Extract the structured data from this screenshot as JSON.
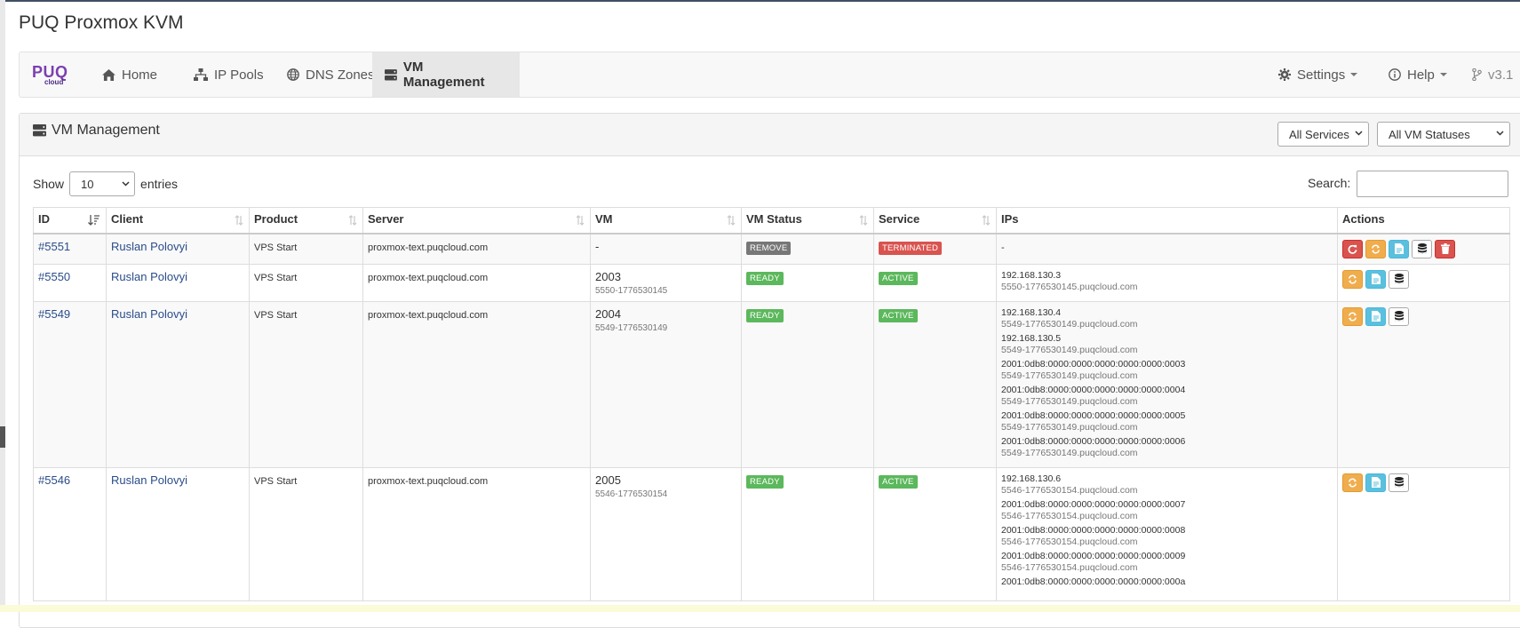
{
  "app": {
    "title": "PUQ Proxmox KVM",
    "logo_main": "PUQ",
    "logo_sub": "cloud"
  },
  "nav": {
    "items": [
      {
        "label": "Home",
        "icon": "home-icon"
      },
      {
        "label": "IP Pools",
        "icon": "sitemap-icon"
      },
      {
        "label": "DNS Zones",
        "icon": "globe-icon"
      },
      {
        "label": "VM Management",
        "icon": "server-icon",
        "active": true
      }
    ],
    "settings": "Settings",
    "help": "Help",
    "version": "v3.1"
  },
  "panel": {
    "title": "VM Management",
    "filter_services": "All Services",
    "filter_statuses": "All VM Statuses"
  },
  "table_controls": {
    "show": "Show",
    "entries_value": "10",
    "entries": "entries",
    "search": "Search:"
  },
  "columns": [
    "ID",
    "Client",
    "Product",
    "Server",
    "VM",
    "VM Status",
    "Service",
    "IPs",
    "Actions"
  ],
  "rows": [
    {
      "id": "#5551",
      "client": "Ruslan Polovyi",
      "product": "VPS Start",
      "server": "proxmox-text.puqcloud.com",
      "vm": "-",
      "vm_sub": "",
      "vm_status": "REMOVE",
      "service": "TERMINATED",
      "ips_text": "-",
      "ips": []
    },
    {
      "id": "#5550",
      "client": "Ruslan Polovyi",
      "product": "VPS Start",
      "server": "proxmox-text.puqcloud.com",
      "vm": "2003",
      "vm_sub": "5550-1776530145",
      "vm_status": "READY",
      "service": "ACTIVE",
      "ips_text": "",
      "ips": [
        {
          "addr": "192.168.130.3",
          "host": "5550-1776530145.puqcloud.com"
        }
      ]
    },
    {
      "id": "#5549",
      "client": "Ruslan Polovyi",
      "product": "VPS Start",
      "server": "proxmox-text.puqcloud.com",
      "vm": "2004",
      "vm_sub": "5549-1776530149",
      "vm_status": "READY",
      "service": "ACTIVE",
      "ips_text": "",
      "ips": [
        {
          "addr": "192.168.130.4",
          "host": "5549-1776530149.puqcloud.com"
        },
        {
          "addr": "192.168.130.5",
          "host": "5549-1776530149.puqcloud.com"
        },
        {
          "addr": "2001:0db8:0000:0000:0000:0000:0000:0003",
          "host": "5549-1776530149.puqcloud.com"
        },
        {
          "addr": "2001:0db8:0000:0000:0000:0000:0000:0004",
          "host": "5549-1776530149.puqcloud.com"
        },
        {
          "addr": "2001:0db8:0000:0000:0000:0000:0000:0005",
          "host": "5549-1776530149.puqcloud.com"
        },
        {
          "addr": "2001:0db8:0000:0000:0000:0000:0000:0006",
          "host": "5549-1776530149.puqcloud.com"
        }
      ]
    },
    {
      "id": "#5546",
      "client": "Ruslan Polovyi",
      "product": "VPS Start",
      "server": "proxmox-text.puqcloud.com",
      "vm": "2005",
      "vm_sub": "5546-1776530154",
      "vm_status": "READY",
      "service": "ACTIVE",
      "ips_text": "",
      "ips": [
        {
          "addr": "192.168.130.6",
          "host": "5546-1776530154.puqcloud.com"
        },
        {
          "addr": "2001:0db8:0000:0000:0000:0000:0000:0007",
          "host": "5546-1776530154.puqcloud.com"
        },
        {
          "addr": "2001:0db8:0000:0000:0000:0000:0000:0008",
          "host": "5546-1776530154.puqcloud.com"
        },
        {
          "addr": "2001:0db8:0000:0000:0000:0000:0000:0009",
          "host": "5546-1776530154.puqcloud.com"
        },
        {
          "addr": "2001:0db8:0000:0000:0000:0000:0000:000a",
          "host": ""
        }
      ]
    }
  ],
  "colors": {
    "remove": "#777777",
    "terminated": "#d9534f",
    "ready": "#5cb85c",
    "active": "#5cb85c",
    "link": "#2a4d8a"
  }
}
